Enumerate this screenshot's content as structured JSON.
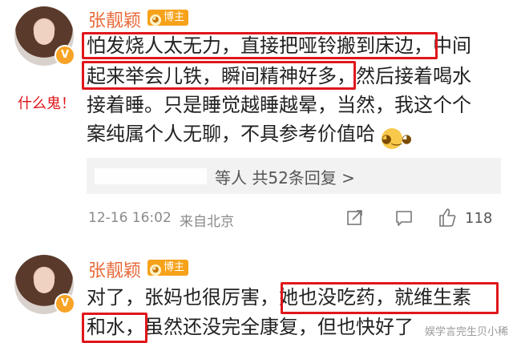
{
  "post1": {
    "username": "张靓颖",
    "badge": "博主",
    "lines": [
      "怕发烧人太无力，直接把哑铃搬到床边，中间",
      "起来举会儿铁，瞬间精神好多，然后接着喝水",
      "接着睡。只是睡觉越睡越晕，当然，我这个个",
      "案纯属个人无聊，不具参考价值哈"
    ],
    "reply_summary": "等人 共52条回复 >",
    "timestamp": "12-16 16:02",
    "source": "来自北京",
    "likes": "118"
  },
  "annotation": "什么鬼！",
  "post2": {
    "username": "张靓颖",
    "badge": "博主",
    "lines": [
      "对了，张妈也很厉害，她也没吃药，就维生素",
      "和水，虽然还没完全康复，但也快好了"
    ]
  },
  "watermark": "娱学言完生贝小稀",
  "colors": {
    "highlight_box": "#e0161b",
    "username": "#e86a3a",
    "badge": "#f6a21a"
  },
  "icons": [
    "verified-v-icon",
    "dog-badge-icon",
    "doge-emoji-icon",
    "share-icon",
    "comment-icon",
    "thumbs-up-icon"
  ]
}
